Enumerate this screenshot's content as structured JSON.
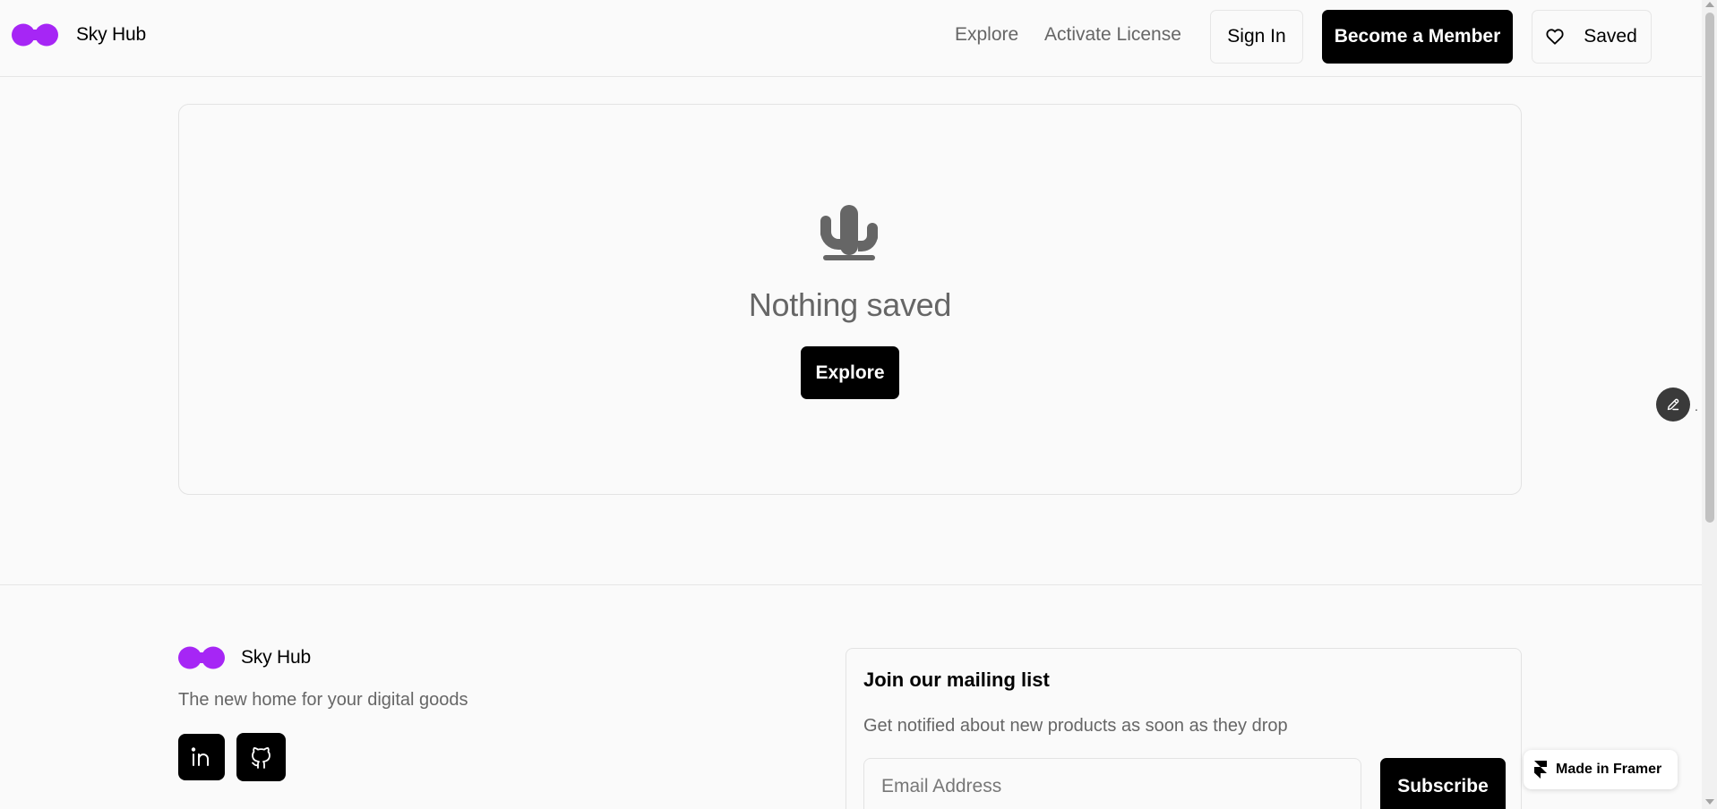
{
  "colors": {
    "accent": "#a626f5",
    "primary_button": "#000000",
    "muted_text": "#666666",
    "background": "#fafafa",
    "border": "#e6e6e6"
  },
  "header": {
    "brand": {
      "name": "Sky Hub",
      "logo_icon": "logo-blob-icon"
    },
    "nav": [
      {
        "label": "Explore"
      },
      {
        "label": "Activate License"
      }
    ],
    "sign_in_label": "Sign In",
    "member_label": "Become a Member",
    "saved": {
      "label": "Saved",
      "icon": "heart-icon"
    }
  },
  "empty_state": {
    "icon": "cactus-icon",
    "title": "Nothing saved",
    "button_label": "Explore"
  },
  "edit_button": {
    "icon": "pencil-icon",
    "suffix": "."
  },
  "footer": {
    "brand": {
      "name": "Sky Hub",
      "logo_icon": "logo-blob-icon"
    },
    "tagline": "The new home for your digital goods",
    "social": [
      {
        "name": "linkedin",
        "icon": "linkedin-icon"
      },
      {
        "name": "github",
        "icon": "github-icon"
      }
    ],
    "mailing": {
      "title": "Join our mailing list",
      "subtitle": "Get notified about new products as soon as they drop",
      "email_placeholder": "Email Address",
      "email_value": "",
      "subscribe_label": "Subscribe"
    }
  },
  "framer_badge": {
    "label": "Made in Framer",
    "icon": "framer-icon"
  }
}
